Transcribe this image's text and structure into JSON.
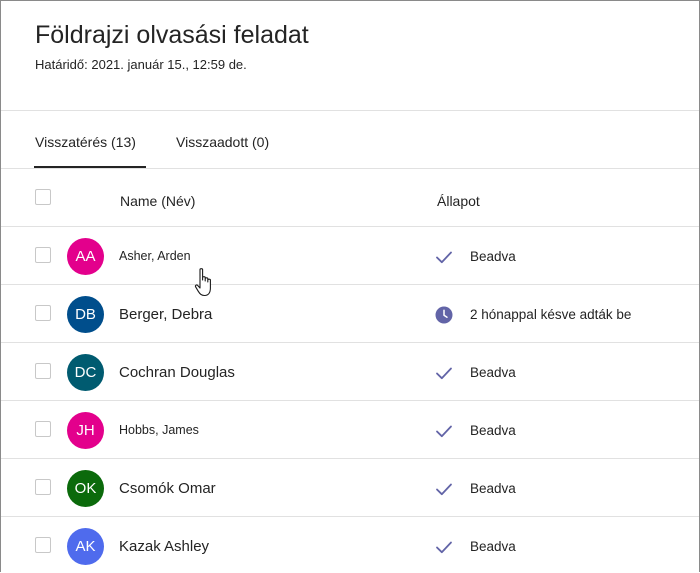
{
  "header": {
    "title": "Földrajzi olvasási feladat",
    "due": "Határidő: 2021. január 15., 12:59 de."
  },
  "tabs": [
    {
      "label": "Visszatérés (13)",
      "active": true
    },
    {
      "label": "Visszaadott (0)",
      "active": false
    }
  ],
  "table": {
    "columns": {
      "name": "Name (Név)",
      "status": "Állapot"
    },
    "rows": [
      {
        "initials": "AA",
        "name": "Asher, Arden",
        "avatar_color": "#e3008c",
        "status": "Beadva",
        "status_icon": "check-icon"
      },
      {
        "initials": "DB",
        "name": "Berger, Debra",
        "avatar_color": "#004e8c",
        "status": "2 hónappal késve adták be",
        "status_icon": "clock-icon"
      },
      {
        "initials": "DC",
        "name": "Cochran Douglas",
        "avatar_color": "#005b70",
        "status": "Beadva",
        "status_icon": "check-icon"
      },
      {
        "initials": "JH",
        "name": "Hobbs, James",
        "avatar_color": "#e3008c",
        "status": "Beadva",
        "status_icon": "check-icon"
      },
      {
        "initials": "OK",
        "name": "Csomók Omar",
        "avatar_color": "#0b6a0b",
        "status": "Beadva",
        "status_icon": "check-icon"
      },
      {
        "initials": "AK",
        "name": "Kazak Ashley",
        "avatar_color": "#4f6bed",
        "status": "Beadva",
        "status_icon": "check-icon"
      }
    ]
  },
  "colors": {
    "accent": "#6264a7",
    "divider": "#e1e1e1",
    "text": "#242424"
  }
}
